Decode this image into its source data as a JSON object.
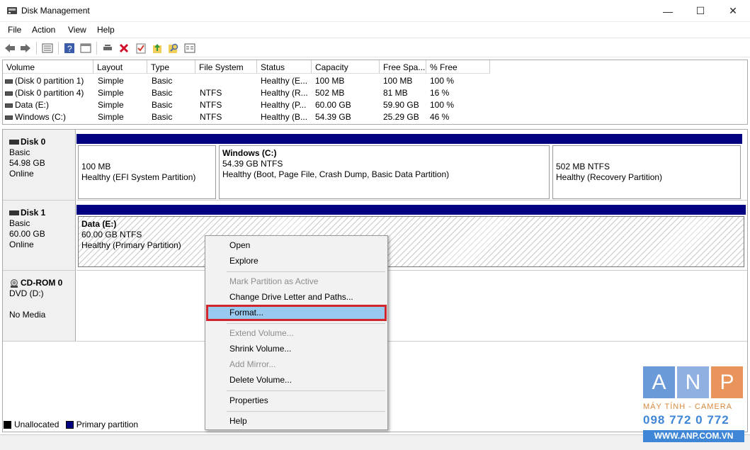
{
  "window": {
    "title": "Disk Management",
    "controls": {
      "minimize": "—",
      "maximize": "☐",
      "close": "✕"
    }
  },
  "menu": [
    "File",
    "Action",
    "View",
    "Help"
  ],
  "toolbar_icons": [
    "back-icon",
    "forward-icon",
    "properties-list-icon",
    "help-icon",
    "view-icon",
    "connect-icon",
    "delete-icon",
    "check-icon",
    "upload-icon",
    "search-icon",
    "settings-icon"
  ],
  "volume_list": {
    "columns": [
      "Volume",
      "Layout",
      "Type",
      "File System",
      "Status",
      "Capacity",
      "Free Spa...",
      "% Free"
    ],
    "rows": [
      [
        "(Disk 0 partition 1)",
        "Simple",
        "Basic",
        "",
        "Healthy (E...",
        "100 MB",
        "100 MB",
        "100 %"
      ],
      [
        "(Disk 0 partition 4)",
        "Simple",
        "Basic",
        "NTFS",
        "Healthy (R...",
        "502 MB",
        "81 MB",
        "16 %"
      ],
      [
        "Data (E:)",
        "Simple",
        "Basic",
        "NTFS",
        "Healthy (P...",
        "60.00 GB",
        "59.90 GB",
        "100 %"
      ],
      [
        "Windows (C:)",
        "Simple",
        "Basic",
        "NTFS",
        "Healthy (B...",
        "54.39 GB",
        "25.29 GB",
        "46 %"
      ]
    ]
  },
  "disks": [
    {
      "name": "Disk 0",
      "type": "Basic",
      "size": "54.98 GB",
      "status": "Online",
      "partitions": [
        {
          "title": "",
          "line1": "100 MB",
          "line2": "Healthy (EFI System Partition)"
        },
        {
          "title": "Windows  (C:)",
          "line1": "54.39 GB NTFS",
          "line2": "Healthy (Boot, Page File, Crash Dump, Basic Data Partition)"
        },
        {
          "title": "",
          "line1": "502 MB NTFS",
          "line2": "Healthy (Recovery Partition)"
        }
      ]
    },
    {
      "name": "Disk 1",
      "type": "Basic",
      "size": "60.00 GB",
      "status": "Online",
      "partitions": [
        {
          "title": "Data  (E:)",
          "line1": "60.00 GB NTFS",
          "line2": "Healthy (Primary Partition)"
        }
      ]
    },
    {
      "name": "CD-ROM 0",
      "type": "DVD (D:)",
      "size": "",
      "status": "No Media",
      "partitions": []
    }
  ],
  "legend": [
    {
      "label": "Unallocated",
      "color": "#000000"
    },
    {
      "label": "Primary partition",
      "color": "#000080"
    }
  ],
  "context_menu": {
    "items": [
      {
        "label": "Open",
        "enabled": true
      },
      {
        "label": "Explore",
        "enabled": true
      },
      {
        "label": "Mark Partition as Active",
        "enabled": false
      },
      {
        "label": "Change Drive Letter and Paths...",
        "enabled": true
      },
      {
        "label": "Format...",
        "enabled": true,
        "highlighted": true
      },
      {
        "label": "Extend Volume...",
        "enabled": false
      },
      {
        "label": "Shrink Volume...",
        "enabled": true
      },
      {
        "label": "Add Mirror...",
        "enabled": false
      },
      {
        "label": "Delete Volume...",
        "enabled": true
      },
      {
        "label": "Properties",
        "enabled": true
      },
      {
        "label": "Help",
        "enabled": true
      }
    ]
  },
  "watermark": {
    "letters": [
      "A",
      "N",
      "P"
    ],
    "letter_colors": [
      "#6b9ad8",
      "#8fb0e0",
      "#e8945a"
    ],
    "subtitle": "MÁY TÍNH - CAMERA",
    "phone": "098 772 0 772",
    "url": "WWW.ANP.COM.VN"
  }
}
